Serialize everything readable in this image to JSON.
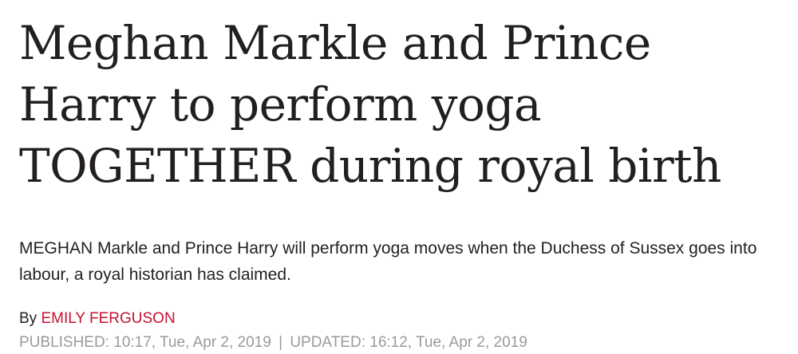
{
  "article": {
    "headline": "Meghan Markle and Prince Harry to perform yoga TOGETHER during royal birth",
    "standfirst": "MEGHAN Markle and Prince Harry will perform yoga moves when the Duchess of Sussex goes into labour, a royal historian has claimed.",
    "byline_prefix": "By",
    "author": "EMILY FERGUSON",
    "published": "PUBLISHED: 10:17, Tue, Apr 2, 2019",
    "separator": "|",
    "updated": "UPDATED: 16:12, Tue, Apr 2, 2019"
  },
  "colors": {
    "headline": "#231f20",
    "author_link": "#c8102e",
    "meta": "#9a9a9a"
  }
}
